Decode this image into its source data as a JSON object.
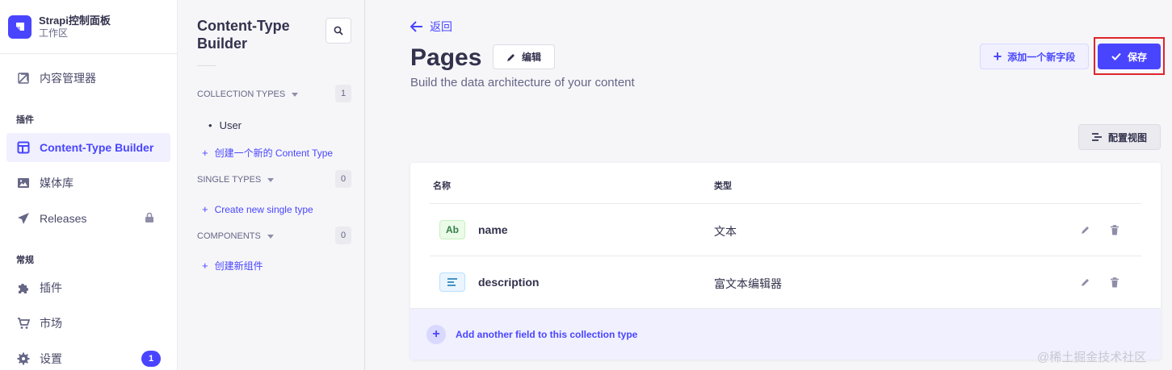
{
  "app": {
    "name": "Strapi控制面板",
    "workspace": "工作区"
  },
  "mainnav": {
    "content_manager": "内容管理器",
    "plugins_section": "插件",
    "ctb": "Content-Type Builder",
    "media": "媒体库",
    "releases": "Releases",
    "general_section": "常规",
    "plugins": "插件",
    "market": "市场",
    "settings": "设置",
    "settings_badge": "1"
  },
  "subnav": {
    "title": "Content-Type Builder",
    "collection_types": {
      "label": "COLLECTION TYPES",
      "count": "1",
      "items": [
        "User"
      ],
      "create": "创建一个新的 Content Type"
    },
    "single_types": {
      "label": "SINGLE TYPES",
      "count": "0",
      "create": "Create new single type"
    },
    "components": {
      "label": "COMPONENTS",
      "count": "0",
      "create": "创建新组件"
    }
  },
  "main": {
    "back": "返回",
    "title": "Pages",
    "edit": "编辑",
    "subtitle": "Build the data architecture of your content",
    "add_field": "添加一个新字段",
    "save": "保存",
    "configure_view": "配置视图",
    "table": {
      "col_name": "名称",
      "col_type": "类型",
      "rows": [
        {
          "icon": "Ab",
          "name": "name",
          "type": "文本"
        },
        {
          "icon": "rich-text-icon",
          "name": "description",
          "type": "富文本编辑器"
        }
      ]
    },
    "add_another": "Add another field to this collection type"
  },
  "watermark": "@稀土掘金技术社区",
  "colors": {
    "primary": "#4945ff",
    "highlight": "#e0242b"
  }
}
